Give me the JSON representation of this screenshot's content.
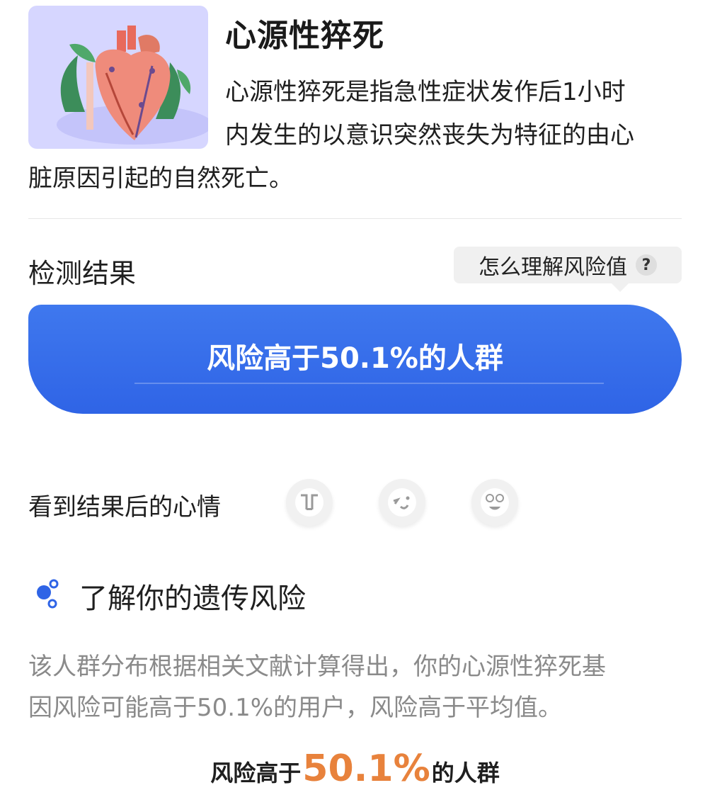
{
  "header": {
    "title": "心源性猝死",
    "description_lines": [
      "心源性猝死是指急性症状发作后1小时",
      "内发生的以意识突然丧失为特征的由心",
      "脏原因引起的自然死亡。"
    ],
    "image_icon": "heart-illustration"
  },
  "result": {
    "section_title": "检测结果",
    "help_label": "怎么理解风险值",
    "help_icon": "question-icon",
    "banner_text": "风险高于50.1%的人群"
  },
  "mood": {
    "label": "看到结果后的心情",
    "options": [
      "crying-face-icon",
      "wink-face-icon",
      "happy-face-icon"
    ]
  },
  "gene": {
    "icon": "gene-node-icon",
    "title": "了解你的遗传风险",
    "description_lines": [
      "该人群分布根据相关文献计算得出，你的心源性猝死基",
      "因风险可能高于50.1%的用户，风险高于平均值。"
    ]
  },
  "summary": {
    "prefix": "风险高于",
    "percent": "50.1%",
    "suffix": "的人群"
  },
  "colors": {
    "banner_blue": "#2f64e6",
    "accent_orange": "#e8823c",
    "image_bg": "#d6d6ff"
  }
}
